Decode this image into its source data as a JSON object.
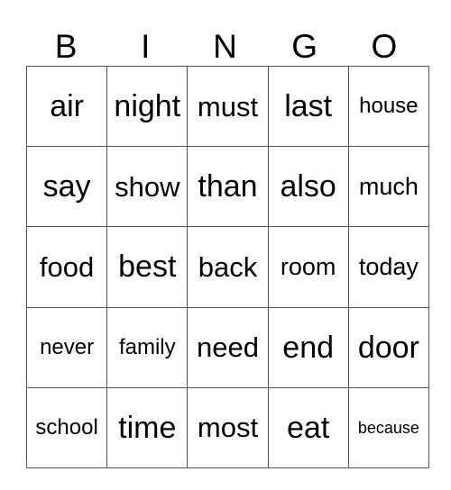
{
  "header": {
    "letters": [
      "B",
      "I",
      "N",
      "G",
      "O"
    ]
  },
  "grid": {
    "rows": [
      [
        "air",
        "night",
        "must",
        "last",
        "house"
      ],
      [
        "say",
        "show",
        "than",
        "also",
        "much"
      ],
      [
        "food",
        "best",
        "back",
        "room",
        "today"
      ],
      [
        "never",
        "family",
        "need",
        "end",
        "door"
      ],
      [
        "school",
        "time",
        "most",
        "eat",
        "because"
      ]
    ]
  }
}
